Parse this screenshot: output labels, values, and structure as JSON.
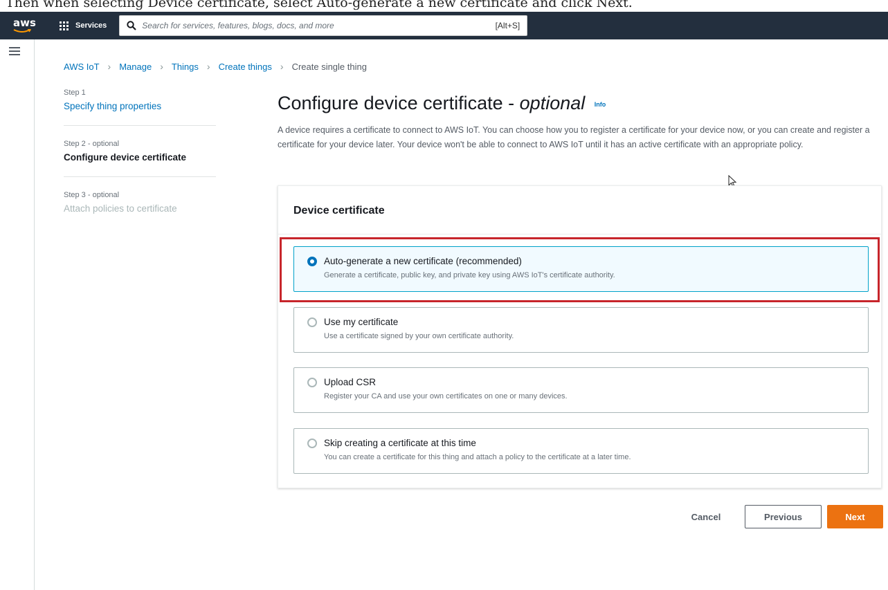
{
  "caption": "Then when selecting Device certificate, select Auto-generate a new certificate and click Next.",
  "topbar": {
    "logo": "aws",
    "services_label": "Services",
    "search_placeholder": "Search for services, features, blogs, docs, and more",
    "search_shortcut": "[Alt+S]",
    "background": "#232f3e"
  },
  "breadcrumb": [
    "AWS IoT",
    "Manage",
    "Things",
    "Create things",
    "Create single thing"
  ],
  "steps": [
    {
      "step": "Step 1",
      "label": "Specify thing properties",
      "state": "link"
    },
    {
      "step": "Step 2 - optional",
      "label": "Configure device certificate",
      "state": "current"
    },
    {
      "step": "Step 3 - optional",
      "label": "Attach policies to certificate",
      "state": "disabled"
    }
  ],
  "main": {
    "title_prefix": "Configure device certificate - ",
    "title_optional": "optional",
    "info_link": "Info",
    "description": "A device requires a certificate to connect to AWS IoT. You can choose how you to register a certificate for your device now, or you can create and register a certificate for your device later. Your device won't be able to connect to AWS IoT until it has an active certificate with an appropriate policy."
  },
  "panel": {
    "title": "Device certificate",
    "options": [
      {
        "title": "Auto-generate a new certificate (recommended)",
        "description": "Generate a certificate, public key, and private key using AWS IoT's certificate authority.",
        "selected": true
      },
      {
        "title": "Use my certificate",
        "description": "Use a certificate signed by your own certificate authority.",
        "selected": false
      },
      {
        "title": "Upload CSR",
        "description": "Register your CA and use your own certificates on one or many devices.",
        "selected": false
      },
      {
        "title": "Skip creating a certificate at this time",
        "description": "You can create a certificate for this thing and attach a policy to the certificate at a later time.",
        "selected": false
      }
    ]
  },
  "actions": {
    "cancel": "Cancel",
    "previous": "Previous",
    "next": "Next"
  },
  "colors": {
    "accent_link": "#0073bb",
    "primary_button": "#ec7211",
    "highlight_box": "#c7252b",
    "selected_border": "#00a1c9"
  }
}
